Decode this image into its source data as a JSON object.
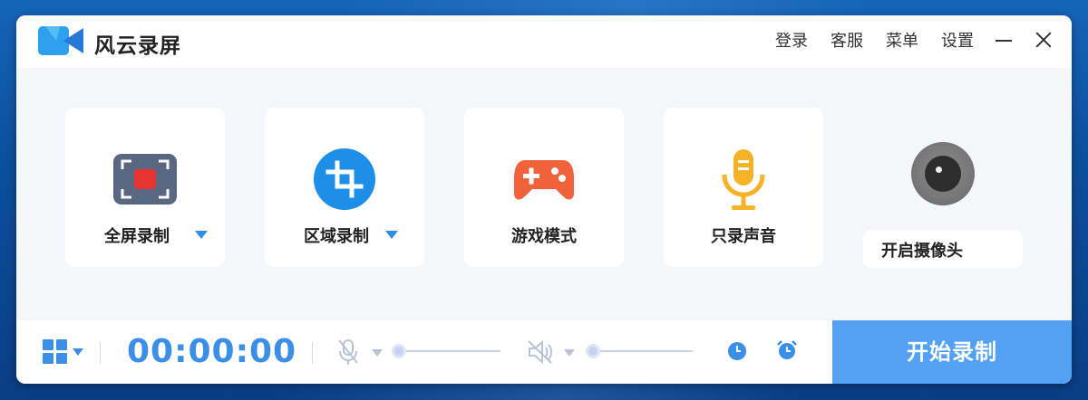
{
  "app": {
    "title": "风云录屏"
  },
  "menu": {
    "login": "登录",
    "service": "客服",
    "menu": "菜单",
    "settings": "设置"
  },
  "modes": [
    {
      "label": "全屏录制"
    },
    {
      "label": "区域录制"
    },
    {
      "label": "游戏模式"
    },
    {
      "label": "只录声音"
    }
  ],
  "camera": {
    "label": "开启摄像头"
  },
  "bottom": {
    "timer": "00:00:00",
    "mic_volume_percent": 0,
    "speaker_volume_percent": 0,
    "start_label": "开始录制"
  },
  "colors": {
    "accent": "#3b8fe6",
    "start_button": "#53a1f2",
    "fullscreen_icon_bg": "#5a6782",
    "fullscreen_icon_rec": "#e8342e",
    "region_icon": "#1e8fe8",
    "game_icon": "#f0623a",
    "mic_icon": "#f5b325",
    "camera_icon": "#777777"
  },
  "icons": {
    "logo": "video-camera-logo",
    "fullscreen": "fullscreen-record-icon",
    "region": "crop-icon",
    "game": "gamepad-icon",
    "audio": "microphone-icon",
    "camera": "webcam-icon",
    "layout": "grid-icon",
    "mic_muted": "mic-off-icon",
    "speaker_muted": "speaker-off-icon",
    "timer": "clock-icon",
    "alarm": "alarm-icon"
  }
}
